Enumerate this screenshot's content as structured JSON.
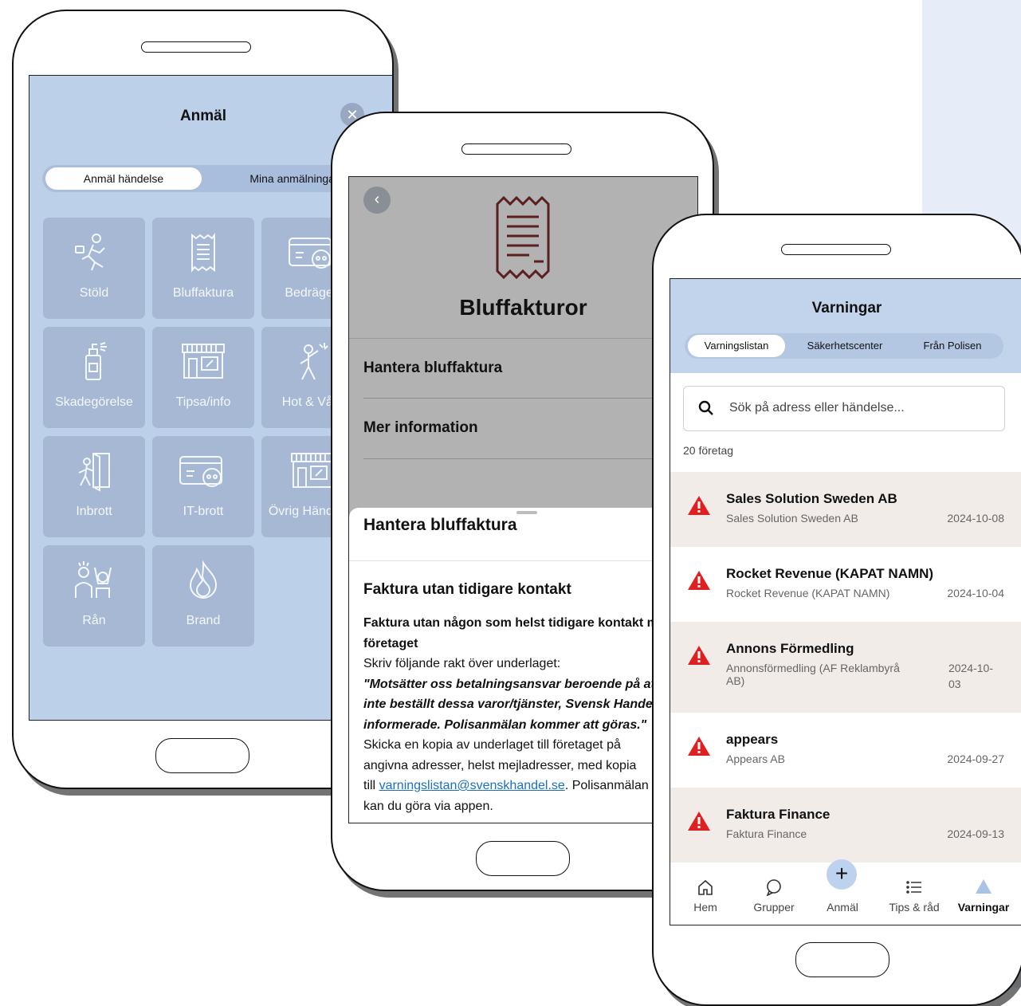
{
  "report_screen": {
    "title": "Anmäl",
    "close_glyph": "✕",
    "tabs": [
      "Anmäl händelse",
      "Mina anmälningar"
    ],
    "tiles": [
      {
        "label": "Stöld",
        "icon": "running-thief-icon"
      },
      {
        "label": "Bluffaktura",
        "icon": "receipt-icon"
      },
      {
        "label": "Bedrägeri",
        "icon": "card-skull-icon"
      },
      {
        "label": "Skadegörelse",
        "icon": "spray-can-icon"
      },
      {
        "label": "Tipsa/info",
        "icon": "storefront-icon"
      },
      {
        "label": "Hot & Våld",
        "icon": "threat-person-icon"
      },
      {
        "label": "Inbrott",
        "icon": "door-intruder-icon"
      },
      {
        "label": "IT-brott",
        "icon": "card-skull-icon"
      },
      {
        "label": "Övrig Händelse",
        "icon": "storefront-icon"
      },
      {
        "label": "Rån",
        "icon": "robbery-icon"
      },
      {
        "label": "Brand",
        "icon": "flame-icon"
      }
    ]
  },
  "invoice_screen": {
    "back_glyph": "‹",
    "title": "Bluffakturor",
    "menu": [
      "Hantera bluffaktura",
      "Mer information"
    ],
    "sheet": {
      "title": "Hantera bluffaktura",
      "heading": "Faktura utan tidigare kontakt",
      "line1": "Faktura utan någon som helst tidigare kontakt med",
      "line2": "företaget",
      "line3": "Skriv följande rakt över underlaget:",
      "quote1": "\"Motsätter oss betalningsansvar beroende på att vi",
      "quote2": "inte beställt dessa varor/tjänster, Svensk Handel",
      "quote3": "informerade. Polisanmälan kommer att göras.\"",
      "line4": "Skicka en kopia av underlaget till företaget på",
      "line5": "angivna adresser, helst mejladresser, med kopia",
      "line6_prefix": "till ",
      "email": "varningslistan@svenskhandel.se",
      "line6_suffix": ". Polisanmälan",
      "line7": "kan du göra via appen."
    }
  },
  "warnings_screen": {
    "title": "Varningar",
    "tabs": [
      "Varningslistan",
      "Säkerhetscenter",
      "Från Polisen"
    ],
    "search_placeholder": "Sök på adress eller händelse...",
    "count": "20 företag",
    "items": [
      {
        "title": "Sales Solution Sweden AB",
        "subtitle": "Sales Solution Sweden AB",
        "date": "2024-10-08"
      },
      {
        "title": "Rocket Revenue (KAPAT NAMN)",
        "subtitle": "Rocket Revenue (KAPAT NAMN)",
        "date": "2024-10-04"
      },
      {
        "title": "Annons Förmedling",
        "subtitle_line1": "Annonsförmedling (AF Reklambyrå",
        "subtitle_line2": "AB)",
        "date_line1": "2024-10-",
        "date_line2": "03"
      },
      {
        "title": "appears",
        "subtitle": "Appears AB",
        "date": "2024-09-27"
      },
      {
        "title": "Faktura Finance",
        "subtitle": "Faktura Finance",
        "date": "2024-09-13"
      }
    ],
    "tabbar": [
      {
        "label": "Hem",
        "icon": "home-icon"
      },
      {
        "label": "Grupper",
        "icon": "chat-bubble-icon"
      },
      {
        "label": "Anmäl",
        "icon": "plus-icon"
      },
      {
        "label": "Tips & råd",
        "icon": "list-icon"
      },
      {
        "label": "Varningar",
        "icon": "warning-icon"
      }
    ],
    "colors": {
      "warning_red": "#e02020",
      "header_blue": "#c2d4ec",
      "row_shade": "#f2ece9"
    }
  }
}
